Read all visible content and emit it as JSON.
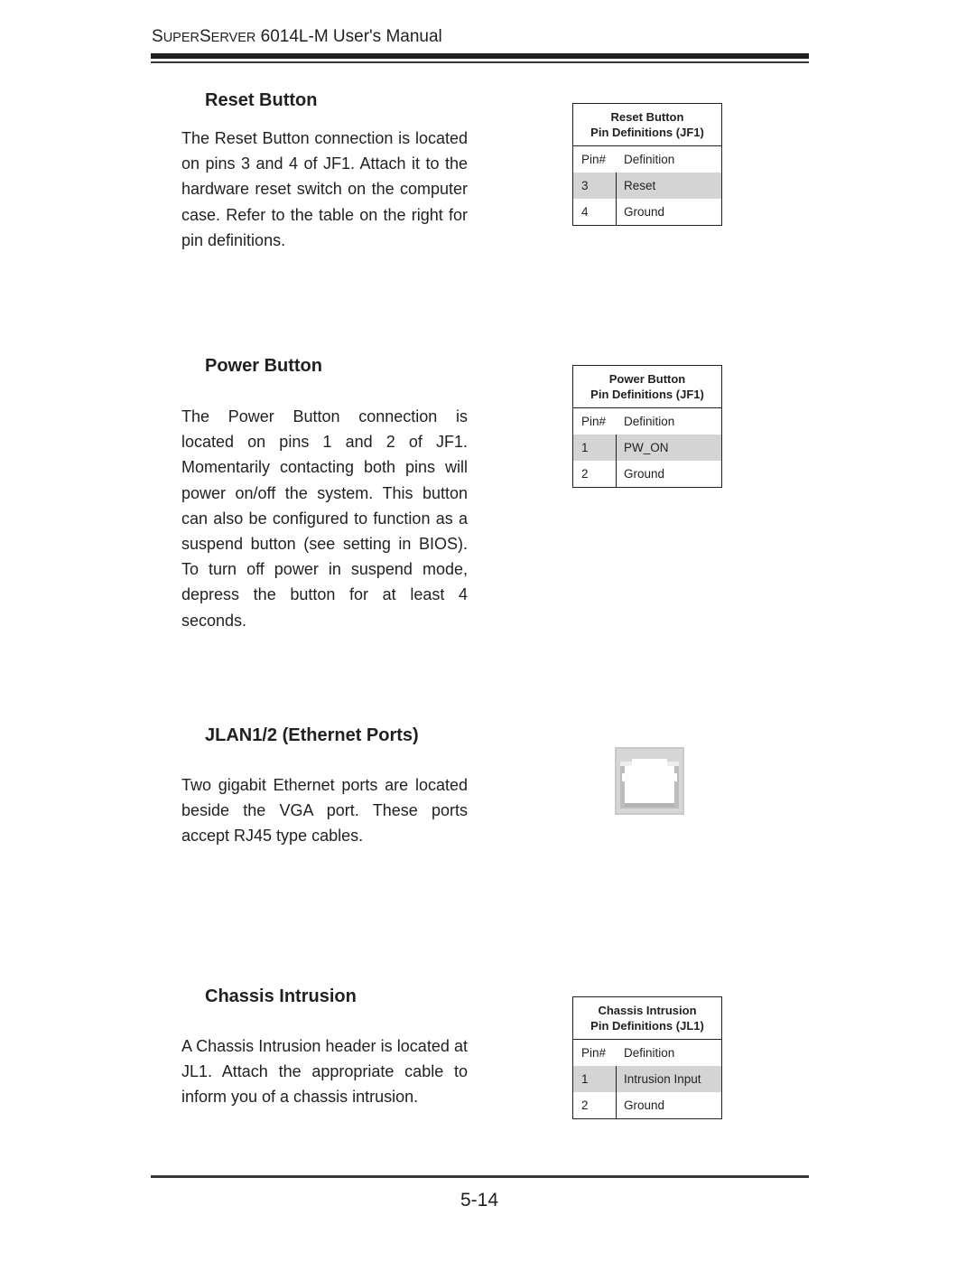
{
  "header": {
    "title_s1": "S",
    "title_sc1": "UPER",
    "title_s2": "S",
    "title_sc2": "ERVER",
    "title_rest": " 6014L-M User's Manual"
  },
  "sections": [
    {
      "heading": "Reset Button",
      "body": "The Reset Button connection is located on pins 3 and 4 of JF1.  Attach it to the hardware reset switch on the computer case.  Refer to the table on the right for pin definitions.",
      "table": {
        "title_line1": "Reset Button",
        "title_line2": "Pin Definitions (JF1)",
        "col_pin": "Pin#",
        "col_def": "Definition",
        "rows": [
          {
            "pin": "3",
            "definition": "Reset"
          },
          {
            "pin": "4",
            "definition": "Ground"
          }
        ]
      }
    },
    {
      "heading": "Power Button",
      "body": "The Power Button connection is located on pins 1 and 2 of JF1.  Momentarily contacting both pins will power on/off the system.  This button can also be configured to function as a suspend button (see setting in BIOS).  To turn off  power in suspend mode, depress the button for at least 4 seconds.",
      "table": {
        "title_line1": "Power Button",
        "title_line2": "Pin Definitions (JF1)",
        "col_pin": "Pin#",
        "col_def": "Definition",
        "rows": [
          {
            "pin": "1",
            "definition": "PW_ON"
          },
          {
            "pin": "2",
            "definition": "Ground"
          }
        ]
      }
    },
    {
      "heading": "JLAN1/2 (Ethernet Ports)",
      "body": "Two gigabit Ethernet ports are located beside the VGA port.  These ports accept RJ45 type cables.",
      "image": "ethernet-port-illustration"
    },
    {
      "heading": "Chassis Intrusion",
      "body": "A Chassis Intrusion header is located at JL1.  Attach the appropriate cable to inform you of a chassis intrusion.",
      "table": {
        "title_line1": "Chassis Intrusion",
        "title_line2": "Pin Definitions (JL1)",
        "col_pin": "Pin#",
        "col_def": "Definition",
        "rows": [
          {
            "pin": "1",
            "definition": "Intrusion Input"
          },
          {
            "pin": "2",
            "definition": "Ground"
          }
        ]
      }
    }
  ],
  "footer": {
    "page_number": "5-14"
  },
  "colors": {
    "text": "#231f20",
    "table_shade": "#d4d4d4"
  }
}
